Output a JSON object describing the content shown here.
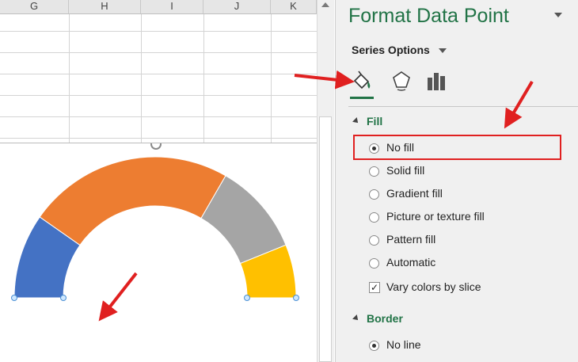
{
  "sheet": {
    "columns": [
      "G",
      "H",
      "I",
      "J",
      "K"
    ]
  },
  "chart_data": {
    "type": "pie",
    "subtype": "half-doughnut gauge",
    "slices": [
      {
        "color": "#4472c4",
        "angle_degrees": 35
      },
      {
        "color": "#ed7d31",
        "angle_degrees": 85
      },
      {
        "color": "#a5a5a5",
        "angle_degrees": 38
      },
      {
        "color": "#ffc000",
        "angle_degrees": 22
      }
    ],
    "hidden_bottom_half": true
  },
  "pane": {
    "title": "Format Data Point",
    "series_options_label": "Series Options",
    "tabs": [
      {
        "name": "fill-line-tab",
        "icon": "paint-bucket-icon",
        "active": true
      },
      {
        "name": "effects-tab",
        "icon": "pentagon-icon"
      },
      {
        "name": "series-options-tab",
        "icon": "bar-chart-icon"
      }
    ],
    "fill_section": {
      "title": "Fill",
      "options": [
        "No fill",
        "Solid fill",
        "Gradient fill",
        "Picture or texture fill",
        "Pattern fill",
        "Automatic"
      ],
      "selected": "No fill",
      "vary_colors_label": "Vary colors by slice",
      "vary_colors_checked": true
    },
    "border_section": {
      "title": "Border",
      "options": [
        "No line"
      ],
      "selected": "No line"
    }
  },
  "annotations": {
    "arrow_color": "#e02020",
    "highlight_color": "#e02020"
  },
  "colors": {
    "accent": "#217346",
    "pane_bg": "#f0f0f0"
  }
}
